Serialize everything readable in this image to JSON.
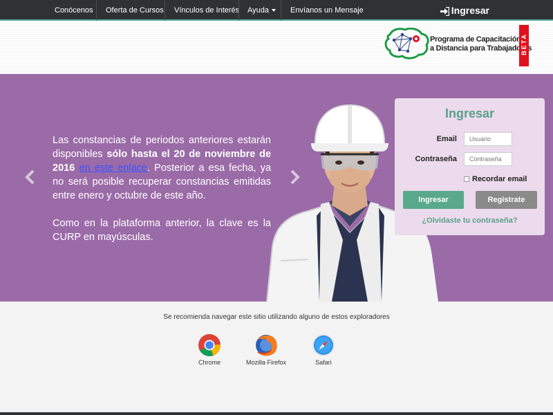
{
  "nav": {
    "items": [
      {
        "label": "Conócenos"
      },
      {
        "label": "Oferta de Cursos"
      },
      {
        "label": "Vínculos de Interés"
      },
      {
        "label": "Ayuda"
      },
      {
        "label": "Envíanos un Mensaje"
      }
    ],
    "login_label": "Ingresar"
  },
  "logo": {
    "line1": "Programa de Capacitación",
    "line2": "a Distancia para Trabajadores",
    "badge": "BETA"
  },
  "hero": {
    "p1_a": "Las constancias de periodos anteriores estarán disponibles ",
    "p1_bold": "sólo hasta el 20 de noviembre de 2016",
    "p1_space": " ",
    "p1_link": "en este enlace",
    "p1_b": ". Posterior a esa fecha, ya no será posible recuperar constancias emitidas entre enero y octubre de este año.",
    "p2": "Como en la plataforma anterior, la clave es la CURP en mayúsculas."
  },
  "login": {
    "title": "Ingresar",
    "email_label": "Email",
    "email_placeholder": "Usuario",
    "password_label": "Contraseña",
    "password_placeholder": "Contraseña",
    "remember_label": "Recordar email",
    "submit_label": "Ingresar",
    "register_label": "Registrate",
    "forgot_label": "¿Olvidaste tu contraseña?"
  },
  "browsers": {
    "intro": "Se recomienda navegar este sitio utilizando alguno de estos exploradores",
    "items": [
      {
        "name": "Chrome",
        "icon": "chrome-icon"
      },
      {
        "name": "Mozilla Firefox",
        "icon": "firefox-icon"
      },
      {
        "name": "Safari",
        "icon": "safari-icon"
      }
    ]
  },
  "colors": {
    "nav_bg": "#2f3132",
    "hero_bg": "#9b6ba8",
    "accent_green": "#5aa98c",
    "beta_red": "#e0111d"
  }
}
